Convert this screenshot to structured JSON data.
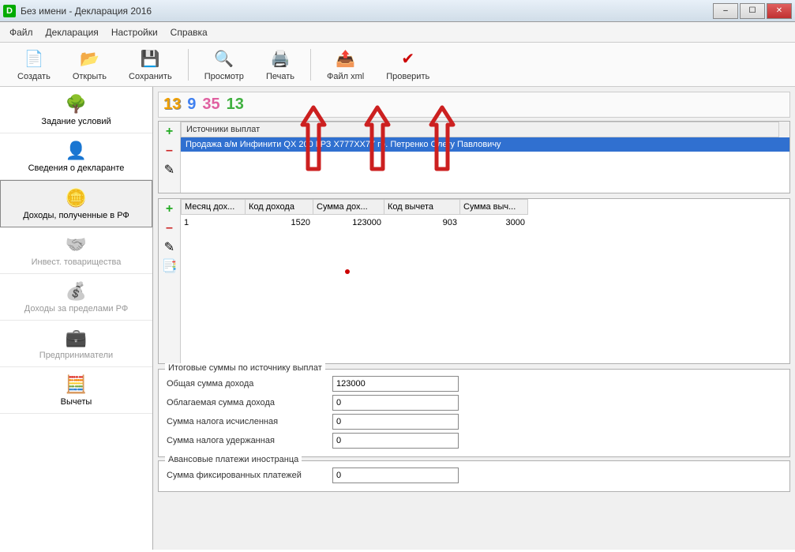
{
  "window": {
    "title": "Без имени - Декларация 2016"
  },
  "menu": {
    "file": "Файл",
    "decl": "Декларация",
    "settings": "Настройки",
    "help": "Справка"
  },
  "toolbar": {
    "create": "Создать",
    "open": "Открыть",
    "save": "Сохранить",
    "preview": "Просмотр",
    "print": "Печать",
    "xml": "Файл xml",
    "check": "Проверить"
  },
  "tax_badges": {
    "b1": "13",
    "b2": "9",
    "b3": "35",
    "b4": "13"
  },
  "sidebar": {
    "items": [
      {
        "label": "Задание условий"
      },
      {
        "label": "Сведения о декларанте"
      },
      {
        "label": "Доходы, полученные в РФ"
      },
      {
        "label": "Инвест. товарищества"
      },
      {
        "label": "Доходы за пределами РФ"
      },
      {
        "label": "Предприниматели"
      },
      {
        "label": "Вычеты"
      }
    ]
  },
  "sources": {
    "header": "Источники выплат",
    "rows": [
      {
        "text": "Продажа а/м Инфинити QX 200 ГРЗ Х777ХХ77 гр. Петренко Олегу Павловичу"
      }
    ]
  },
  "grid": {
    "headers": {
      "c1": "Месяц дох...",
      "c2": "Код дохода",
      "c3": "Сумма дох...",
      "c4": "Код вычета",
      "c5": "Сумма выч..."
    },
    "rows": [
      {
        "c1": "1",
        "c2": "1520",
        "c3": "123000",
        "c4": "903",
        "c5": "3000"
      }
    ]
  },
  "totals": {
    "legend": "Итоговые суммы по источнику выплат",
    "total_income_label": "Общая сумма дохода",
    "total_income": "123000",
    "taxable_label": "Облагаемая сумма дохода",
    "taxable": "0",
    "tax_calc_label": "Сумма налога исчисленная",
    "tax_calc": "0",
    "tax_withheld_label": "Сумма налога удержанная",
    "tax_withheld": "0"
  },
  "advance": {
    "legend": "Авансовые платежи иностранца",
    "fixed_label": "Сумма фиксированных платежей",
    "fixed": "0"
  }
}
